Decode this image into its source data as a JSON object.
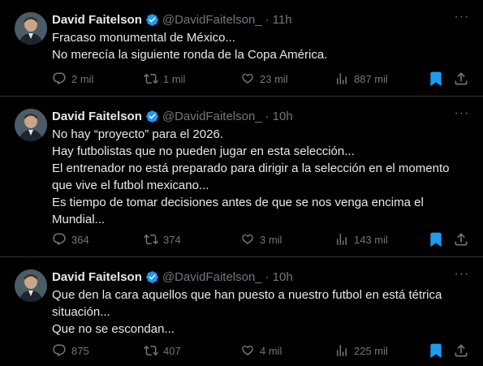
{
  "tweets": [
    {
      "name": "David Faitelson",
      "handle": "@DavidFaitelson_",
      "dot": "·",
      "time": "11h",
      "lines": [
        "Fracaso monumental de México...",
        "No merecía la siguiente ronda de la Copa América."
      ],
      "replies": "2 mil",
      "retweets": "1 mil",
      "likes": "23 mil",
      "views": "887 mil",
      "bookmarked": true
    },
    {
      "name": "David Faitelson",
      "handle": "@DavidFaitelson_",
      "dot": "·",
      "time": "10h",
      "lines": [
        "No hay “proyecto” para el 2026.",
        "Hay futbolistas que no pueden jugar en esta selección...",
        "El entrenador no está preparado para dirigir a la selección en el momento",
        "que vive el futbol mexicano...",
        "Es tiempo de tomar decisiones antes de que se nos venga encima el",
        "Mundial..."
      ],
      "replies": "364",
      "retweets": "374",
      "likes": "3 mil",
      "views": "143 mil",
      "bookmarked": true
    },
    {
      "name": "David Faitelson",
      "handle": "@DavidFaitelson_",
      "dot": "·",
      "time": "10h",
      "lines": [
        "Que den la cara aquellos que han puesto a nuestro futbol en está tétrica",
        "situación...",
        "Que no se  escondan..."
      ],
      "replies": "875",
      "retweets": "407",
      "likes": "4 mil",
      "views": "225 mil",
      "bookmarked": true
    }
  ],
  "more_label": "···",
  "icons": {
    "verified": "verified-badge-icon",
    "reply": "reply-icon",
    "retweet": "retweet-icon",
    "like": "heart-icon",
    "views": "views-bar-chart-icon",
    "bookmark": "bookmark-icon",
    "share": "share-icon"
  },
  "colors": {
    "background": "#000000",
    "text": "#e7e9ea",
    "secondary": "#71767b",
    "verified": "#1d9bf0",
    "bookmark": "#1d9bf0",
    "divider": "#2f3336"
  }
}
